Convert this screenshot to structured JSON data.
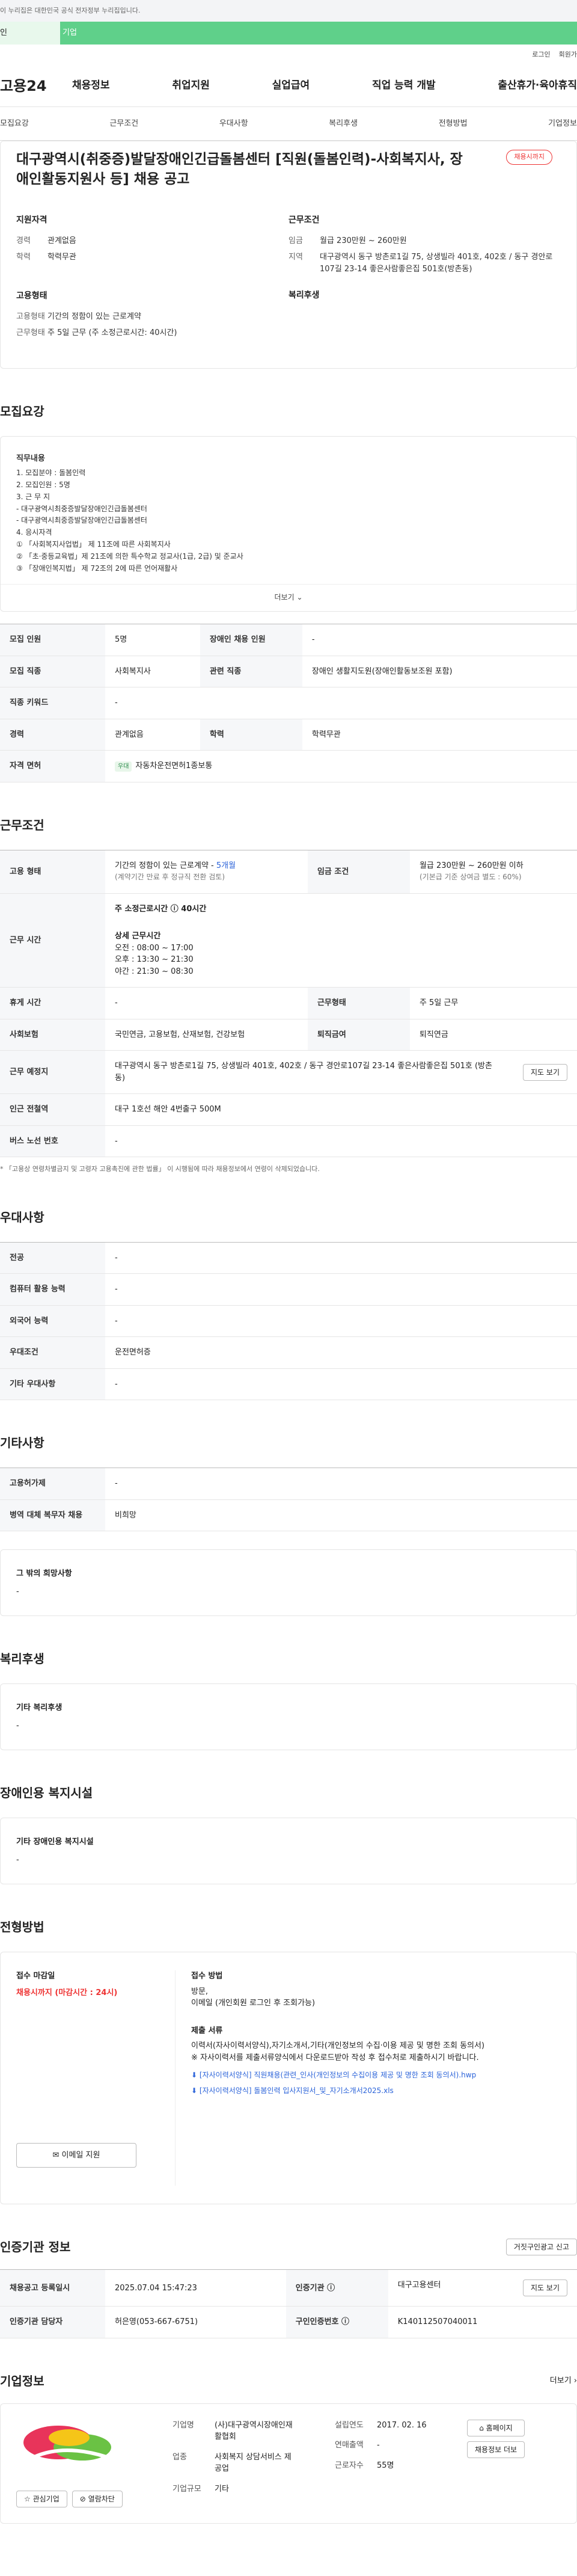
{
  "top_notice": "이 누리집은 대한민국 공식 전자정부 누리집입니다.",
  "gov_banner": {
    "left": "인",
    "right": "기업"
  },
  "util": {
    "login": "로그인",
    "signup": "회원가"
  },
  "logo": "고용24",
  "gnb": [
    "채용정보",
    "취업지원",
    "실업급여",
    "직업 능력 개발",
    "출산휴가·육아휴직"
  ],
  "tabs": [
    "모집요강",
    "근무조건",
    "우대사항",
    "복리후생",
    "전형방법",
    "기업정보"
  ],
  "summary": {
    "title": "대구광역시(취중증)발달장애인긴급돌봄센터 [직원(돌봄인력)-사회복지사, 장애인활동지원사 등] 채용 공고",
    "badge": "채용시까지",
    "qual_title": "지원자격",
    "career_k": "경력",
    "career_v": "관계없음",
    "edu_k": "학력",
    "edu_v": "학력무관",
    "emp_title": "고용형태",
    "emptype_k": "고용형태",
    "emptype_v": "기간의 정함이 있는 근로계약",
    "worktype_k": "근무형태",
    "worktype_v": "주 5일 근무 (주 소정근로시간: 40시간)",
    "cond_title": "근무조건",
    "wage_k": "임금",
    "wage_v": "월급 230만원 ~ 260만원",
    "loc_k": "지역",
    "loc_v": "대구광역시 동구 방촌로1길 75, 상생빌라 401호, 402호 / 동구 경안로107길 23-14 좋은사람좋은집 501호(방촌동)",
    "welfare_title": "복리후생"
  },
  "sec_recruit": "모집요강",
  "job_desc": {
    "h": "직무내용",
    "lines": [
      "1. 모집분야 : 돌봄인력",
      "2. 모집인원 : 5명",
      "3. 근 무 지",
      "  - 대구광역시최중증발달장애인긴급돌봄센터",
      "  - 대구광역시최중증발달장애인긴급돌봄센터",
      "4. 응시자격",
      "① 「사회복지사업법」 제 11조에 따른 사회복지사",
      "② 「초·중등교육법」제 21조에 의한 특수학교 정교사(1급, 2급) 및 준교사",
      "③ 「장애인복지법」 제 72조의 2에 따른 언어재활사"
    ],
    "more": "더보기"
  },
  "recruit_table": [
    [
      "모집 인원",
      "5명",
      "장애인 채용 인원",
      "-"
    ],
    [
      "모집 직종",
      "사회복지사",
      "관련 직종",
      "장애인 생활지도원(장애인활동보조원 포함)"
    ],
    [
      "직종 키워드",
      "-",
      "",
      ""
    ],
    [
      "경력",
      "관계없음",
      "학력",
      "학력무관"
    ]
  ],
  "license_k": "자격 면허",
  "license_tag": "우대",
  "license_v": "자동차운전면허1종보통",
  "sec_work": "근무조건",
  "work": {
    "emp_k": "고용 형태",
    "emp_v": "기간의 정함이 있는 근로계약 - ",
    "emp_months": "5개월",
    "emp_sub": "(계약기간 만료 후 정규직 전환 검토)",
    "wage_k": "임금 조건",
    "wage_v": "월급 230만원 ~ 260만원 이하",
    "wage_sub": "(기본급 기준 상여금 별도 : 60%)",
    "time_k": "근무 시간",
    "time_total": "주 소정근로시간 ⓘ 40시간",
    "time_detail_h": "상세 근무시간",
    "time_lines": [
      "오전 : 08:00 ~ 17:00",
      "오후 : 13:30 ~ 21:30",
      "야간 : 21:30 ~ 08:30"
    ],
    "rest_k": "휴게 시간",
    "rest_v": "-",
    "worktype_k": "근무형태",
    "worktype_v": "주 5일 근무",
    "ins_k": "사회보험",
    "ins_v": "국민연금, 고용보험, 산재보험, 건강보험",
    "ret_k": "퇴직금여",
    "ret_v": "퇴직연금",
    "place_k": "근무 예정지",
    "place_v": "대구광역시 동구 방촌로1길 75, 상생빌라 401호, 402호 / 동구 경안로107길 23-14 좋은사람좋은집 501호 (방촌동)",
    "map_btn": "지도 보기",
    "sub_k": "인근 전철역",
    "sub_v": "대구 1호선 해안 4번출구 500M",
    "bus_k": "버스 노선 번호",
    "bus_v": "-"
  },
  "work_note": "* 「고용상 연령차별금지 및 고령자 고용촉진에 관한 법률」 이 시행됨에 따라 채용정보에서 연령이 삭제되었습니다.",
  "sec_pref": "우대사항",
  "pref": [
    [
      "전공",
      "-"
    ],
    [
      "컴퓨터 활용 능력",
      "-"
    ],
    [
      "외국어 능력",
      "-"
    ],
    [
      "우대조건",
      "운전면허증"
    ],
    [
      "기타 우대사항",
      "-"
    ]
  ],
  "sec_etc": "기타사항",
  "etc": [
    [
      "고용허가제",
      "-"
    ],
    [
      "병역 대체 복무자 채용",
      "비희망"
    ]
  ],
  "etc_box": {
    "h": "그 밖의 희망사항",
    "v": "-"
  },
  "sec_welfare": "복리후생",
  "welfare_box": {
    "h": "기타 복리후생",
    "v": "-"
  },
  "sec_disab": "장애인용 복지시설",
  "disab_box": {
    "h": "기타 장애인용 복지시설",
    "v": "-"
  },
  "sec_apply": "전형방법",
  "apply": {
    "deadline_h": "접수 마감일",
    "deadline_v": "채용시까지 (마감시간 : 24시)",
    "email_btn": "이메일 지원",
    "method_h": "접수 방법",
    "method_lines": [
      "방문,",
      "이메일 (개인회원 로그인 후 조회가능)"
    ],
    "docs_h": "제출 서류",
    "docs_lines": [
      "이력서(자사이력서양식),자기소개서,기타(개인정보의 수집·이용 제공 및 명한 조회 동의서)",
      "※ 자사이력서를 제출서류양식에서 다운로드받아 작성 후 접수처로 제출하시기 바랍니다."
    ],
    "files": [
      "[자사이력서양식] 직원채용(관련_인사(개인정보의 수집이용 제공 및 명한 조회 동의서).hwp",
      "[자사이력서양식] 돌봄인력 입사지원서_및_자기소개서2025.xls"
    ]
  },
  "sec_cert": "인증기관 정보",
  "cert_btn": "거짓구인광고 신고",
  "cert_table": [
    [
      "채용공고 등록일시",
      "2025.07.04 15:47:23",
      "인증기관 ⓘ",
      "대구고용센터",
      "지도 보기"
    ],
    [
      "인증기관 담당자",
      "허은영(053-667-6751)",
      "구인인증번호 ⓘ",
      "K140112507040011",
      ""
    ]
  ],
  "sec_company": "기업정보",
  "company_more": "더보기 ›",
  "company": {
    "fav": "관심기업",
    "block": "열람차단",
    "rows": [
      [
        "기업명",
        "(사)대구광역시장애인재활협회"
      ],
      [
        "업종",
        "사회복지 상담서비스 제공업"
      ],
      [
        "기업규모",
        "기타"
      ]
    ],
    "rows2": [
      [
        "설립연도",
        "2017. 02. 16"
      ],
      [
        "연매출액",
        "-"
      ],
      [
        "근로자수",
        "55명"
      ]
    ],
    "home_btn": "홈페이지",
    "listing_btn": "채용정보 더보"
  },
  "colors": {
    "accent": "#2b63d9",
    "red": "#e33333",
    "green": "#5fd08a"
  }
}
